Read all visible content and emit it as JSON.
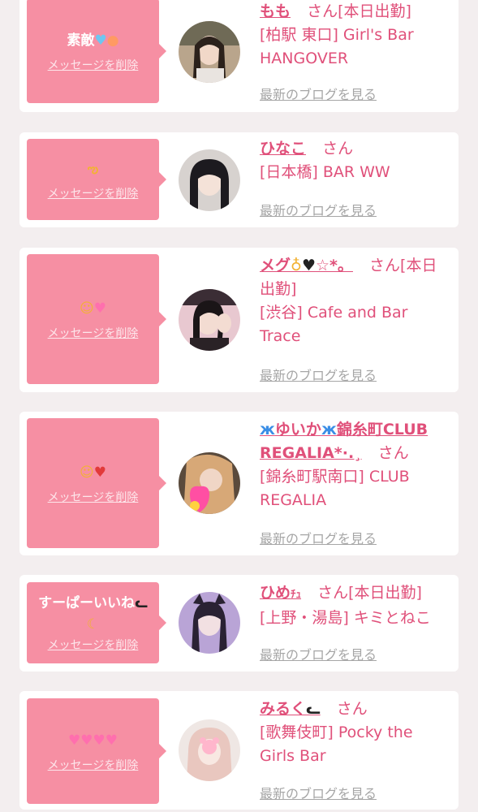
{
  "cards": [
    {
      "message_text": "素敵",
      "message_icons": [
        "blue-heart-icon",
        "peach-icon"
      ],
      "delete_label": "メッセージを削除",
      "name": "もも",
      "san": "さん",
      "status": "[本日出勤]",
      "shop": "[柏駅 東口] Girl's Bar HANGOVER",
      "blog_label": "最新のブログを見る"
    },
    {
      "message_text": "",
      "message_icons": [
        "hands-heart-icon"
      ],
      "delete_label": "メッセージを削除",
      "name": "ひなこ",
      "san": "さん",
      "status": "",
      "shop": "[日本橋] BAR WW",
      "blog_label": "最新のブログを見る"
    },
    {
      "message_text": "",
      "message_icons": [
        "grinning-squint-icon",
        "sparkling-heart-icon"
      ],
      "delete_label": "メッセージを削除",
      "name": "メグ",
      "name_suffix": "☆*。",
      "san": "さん",
      "status": "[本日出勤]",
      "shop": "[渋谷] Cafe and Bar Trace",
      "blog_label": "最新のブログを見る"
    },
    {
      "message_text": "",
      "message_icons": [
        "smiling-face-icon",
        "red-heart-icon"
      ],
      "delete_label": "メッセージを削除",
      "name": "ゆいか",
      "name_suffix": "錦糸町CLUB REGALIA*·.¸",
      "san": "さん",
      "status": "",
      "shop": "[錦糸町駅南口] CLUB REGALIA",
      "blog_label": "最新のブログを見る"
    },
    {
      "message_text": "すーぱーいいね",
      "message_icons": [
        "black-cat-icon",
        "crescent-moon-icon"
      ],
      "delete_label": "メッセージを削除",
      "name": "ひめ",
      "name_suffix": "ﾁｭ",
      "san": "さん",
      "status": "[本日出勤]",
      "shop": "[上野・湯島] キミとねこ",
      "blog_label": "最新のブログを見る"
    },
    {
      "message_text": "",
      "message_icons": [
        "sparkling-heart-icon",
        "sparkling-heart-icon",
        "sparkling-heart-icon",
        "sparkling-heart-icon"
      ],
      "delete_label": "メッセージを削除",
      "name": "みるく",
      "san": "さん",
      "status": "",
      "shop": "[歌舞伎町] Pocky the Girls Bar",
      "blog_label": "最新のブログを見る"
    }
  ],
  "colors": {
    "accent_pink": "#e0507a",
    "bubble_pink": "#f68fa3",
    "muted_gray": "#a6a6a6",
    "background": "#f3eeef"
  }
}
